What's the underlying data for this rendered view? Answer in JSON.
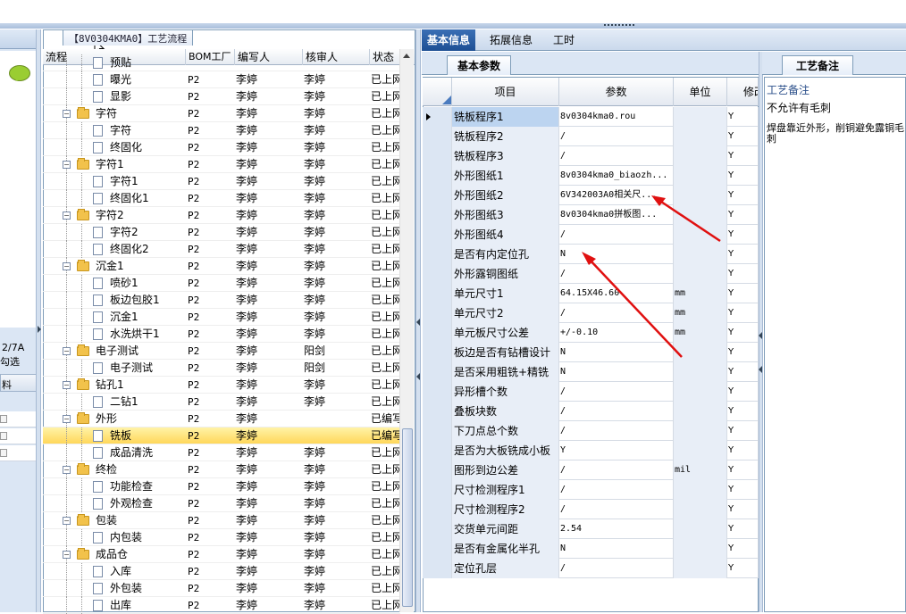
{
  "left_pane": {
    "line1": "2/7A",
    "line2": "勾选",
    "header": "料"
  },
  "tree": {
    "title": "【8V0304KMA0】工艺流程",
    "columns": [
      "流程",
      "BOM工厂",
      "编写人",
      "核审人",
      "状态"
    ],
    "rows": [
      {
        "label": "预贴",
        "bom": "",
        "writer": "",
        "checker": "",
        "status": ""
      },
      {
        "label": "曝光",
        "bom": "P2",
        "writer": "李婷",
        "checker": "李婷",
        "status": "已上网"
      },
      {
        "label": "显影",
        "bom": "P2",
        "writer": "李婷",
        "checker": "李婷",
        "status": "已上网"
      },
      {
        "label": "字符",
        "bom": "P2",
        "writer": "李婷",
        "checker": "李婷",
        "status": "已上网"
      },
      {
        "label": "字符",
        "bom": "P2",
        "writer": "李婷",
        "checker": "李婷",
        "status": "已上网"
      },
      {
        "label": "终固化",
        "bom": "P2",
        "writer": "李婷",
        "checker": "李婷",
        "status": "已上网"
      },
      {
        "label": "字符1",
        "bom": "P2",
        "writer": "李婷",
        "checker": "李婷",
        "status": "已上网"
      },
      {
        "label": "字符1",
        "bom": "P2",
        "writer": "李婷",
        "checker": "李婷",
        "status": "已上网"
      },
      {
        "label": "终固化1",
        "bom": "P2",
        "writer": "李婷",
        "checker": "李婷",
        "status": "已上网"
      },
      {
        "label": "字符2",
        "bom": "P2",
        "writer": "李婷",
        "checker": "李婷",
        "status": "已上网"
      },
      {
        "label": "字符2",
        "bom": "P2",
        "writer": "李婷",
        "checker": "李婷",
        "status": "已上网"
      },
      {
        "label": "终固化2",
        "bom": "P2",
        "writer": "李婷",
        "checker": "李婷",
        "status": "已上网"
      },
      {
        "label": "沉金1",
        "bom": "P2",
        "writer": "李婷",
        "checker": "李婷",
        "status": "已上网"
      },
      {
        "label": "喷砂1",
        "bom": "P2",
        "writer": "李婷",
        "checker": "李婷",
        "status": "已上网"
      },
      {
        "label": "板边包胶1",
        "bom": "P2",
        "writer": "李婷",
        "checker": "李婷",
        "status": "已上网"
      },
      {
        "label": "沉金1",
        "bom": "P2",
        "writer": "李婷",
        "checker": "李婷",
        "status": "已上网"
      },
      {
        "label": "水洗烘干1",
        "bom": "P2",
        "writer": "李婷",
        "checker": "李婷",
        "status": "已上网"
      },
      {
        "label": "电子测试",
        "bom": "P2",
        "writer": "李婷",
        "checker": "阳剑",
        "status": "已上网"
      },
      {
        "label": "电子测试",
        "bom": "P2",
        "writer": "李婷",
        "checker": "阳剑",
        "status": "已上网"
      },
      {
        "label": "钻孔1",
        "bom": "P2",
        "writer": "李婷",
        "checker": "李婷",
        "status": "已上网"
      },
      {
        "label": "二钻1",
        "bom": "P2",
        "writer": "李婷",
        "checker": "李婷",
        "status": "已上网"
      },
      {
        "label": "外形",
        "bom": "P2",
        "writer": "李婷",
        "checker": "",
        "status": "已编写"
      },
      {
        "label": "铣板",
        "bom": "P2",
        "writer": "李婷",
        "checker": "",
        "status": "已编写"
      },
      {
        "label": "成品清洗",
        "bom": "P2",
        "writer": "李婷",
        "checker": "李婷",
        "status": "已上网"
      },
      {
        "label": "终检",
        "bom": "P2",
        "writer": "李婷",
        "checker": "李婷",
        "status": "已上网"
      },
      {
        "label": "功能检查",
        "bom": "P2",
        "writer": "李婷",
        "checker": "李婷",
        "status": "已上网"
      },
      {
        "label": "外观检查",
        "bom": "P2",
        "writer": "李婷",
        "checker": "李婷",
        "status": "已上网"
      },
      {
        "label": "包装",
        "bom": "P2",
        "writer": "李婷",
        "checker": "李婷",
        "status": "已上网"
      },
      {
        "label": "内包装",
        "bom": "P2",
        "writer": "李婷",
        "checker": "李婷",
        "status": "已上网"
      },
      {
        "label": "成品仓",
        "bom": "P2",
        "writer": "李婷",
        "checker": "李婷",
        "status": "已上网"
      },
      {
        "label": "入库",
        "bom": "P2",
        "writer": "李婷",
        "checker": "李婷",
        "status": "已上网"
      },
      {
        "label": "外包装",
        "bom": "P2",
        "writer": "李婷",
        "checker": "李婷",
        "status": "已上网"
      },
      {
        "label": "出库",
        "bom": "P2",
        "writer": "李婷",
        "checker": "李婷",
        "status": "已上网"
      }
    ]
  },
  "right_tabs": [
    "基本信息",
    "拓展信息",
    "工时"
  ],
  "params": {
    "tab": "基本参数",
    "columns": [
      "项目",
      "参数",
      "单位",
      "修改"
    ],
    "rows": [
      {
        "name": "铣板程序1",
        "value": "8v0304kma0.rou",
        "unit": "",
        "mod": "Y"
      },
      {
        "name": "铣板程序2",
        "value": "/",
        "unit": "",
        "mod": "Y"
      },
      {
        "name": "铣板程序3",
        "value": "/",
        "unit": "",
        "mod": "Y"
      },
      {
        "name": "外形图纸1",
        "value": "8v0304kma0_biaozh...",
        "unit": "",
        "mod": "Y"
      },
      {
        "name": "外形图纸2",
        "value": "6V342003A0相关尺...",
        "unit": "",
        "mod": "Y"
      },
      {
        "name": "外形图纸3",
        "value": "8v0304kma0拼板图...",
        "unit": "",
        "mod": "Y"
      },
      {
        "name": "外形图纸4",
        "value": "/",
        "unit": "",
        "mod": "Y"
      },
      {
        "name": "是否有内定位孔",
        "value": "N",
        "unit": "",
        "mod": "Y"
      },
      {
        "name": "外形露铜图纸",
        "value": "/",
        "unit": "",
        "mod": "Y"
      },
      {
        "name": "单元尺寸1",
        "value": "64.15X46.60",
        "unit": "mm",
        "mod": "Y"
      },
      {
        "name": "单元尺寸2",
        "value": "/",
        "unit": "mm",
        "mod": "Y"
      },
      {
        "name": "单元板尺寸公差",
        "value": "+/-0.10",
        "unit": "mm",
        "mod": "Y"
      },
      {
        "name": "板边是否有钻槽设计",
        "value": "N",
        "unit": "",
        "mod": "Y"
      },
      {
        "name": "是否采用粗铣+精铣",
        "value": "N",
        "unit": "",
        "mod": "Y"
      },
      {
        "name": "异形槽个数",
        "value": "/",
        "unit": "",
        "mod": "Y"
      },
      {
        "name": "叠板块数",
        "value": "/",
        "unit": "",
        "mod": "Y"
      },
      {
        "name": "下刀点总个数",
        "value": "/",
        "unit": "",
        "mod": "Y"
      },
      {
        "name": "是否为大板铣成小板",
        "value": "Y",
        "unit": "",
        "mod": "Y"
      },
      {
        "name": "图形到边公差",
        "value": "/",
        "unit": "mil",
        "mod": "Y"
      },
      {
        "name": "尺寸检测程序1",
        "value": "/",
        "unit": "",
        "mod": "Y"
      },
      {
        "name": "尺寸检测程序2",
        "value": "/",
        "unit": "",
        "mod": "Y"
      },
      {
        "name": "交货单元间距",
        "value": "2.54",
        "unit": "",
        "mod": "Y"
      },
      {
        "name": "是否有金属化半孔",
        "value": "N",
        "unit": "",
        "mod": "Y"
      },
      {
        "name": "定位孔层",
        "value": "/",
        "unit": "",
        "mod": "Y"
      }
    ]
  },
  "notes": {
    "tab": "工艺备注",
    "label": "工艺备注",
    "line1": "不允许有毛刺",
    "line2": "焊盘靠近外形，削铜避免露铜毛刺"
  },
  "colors": {
    "accent": "#1d4f94",
    "selected_row": "#ffd75a",
    "annotation_arrow": "#e01010"
  }
}
